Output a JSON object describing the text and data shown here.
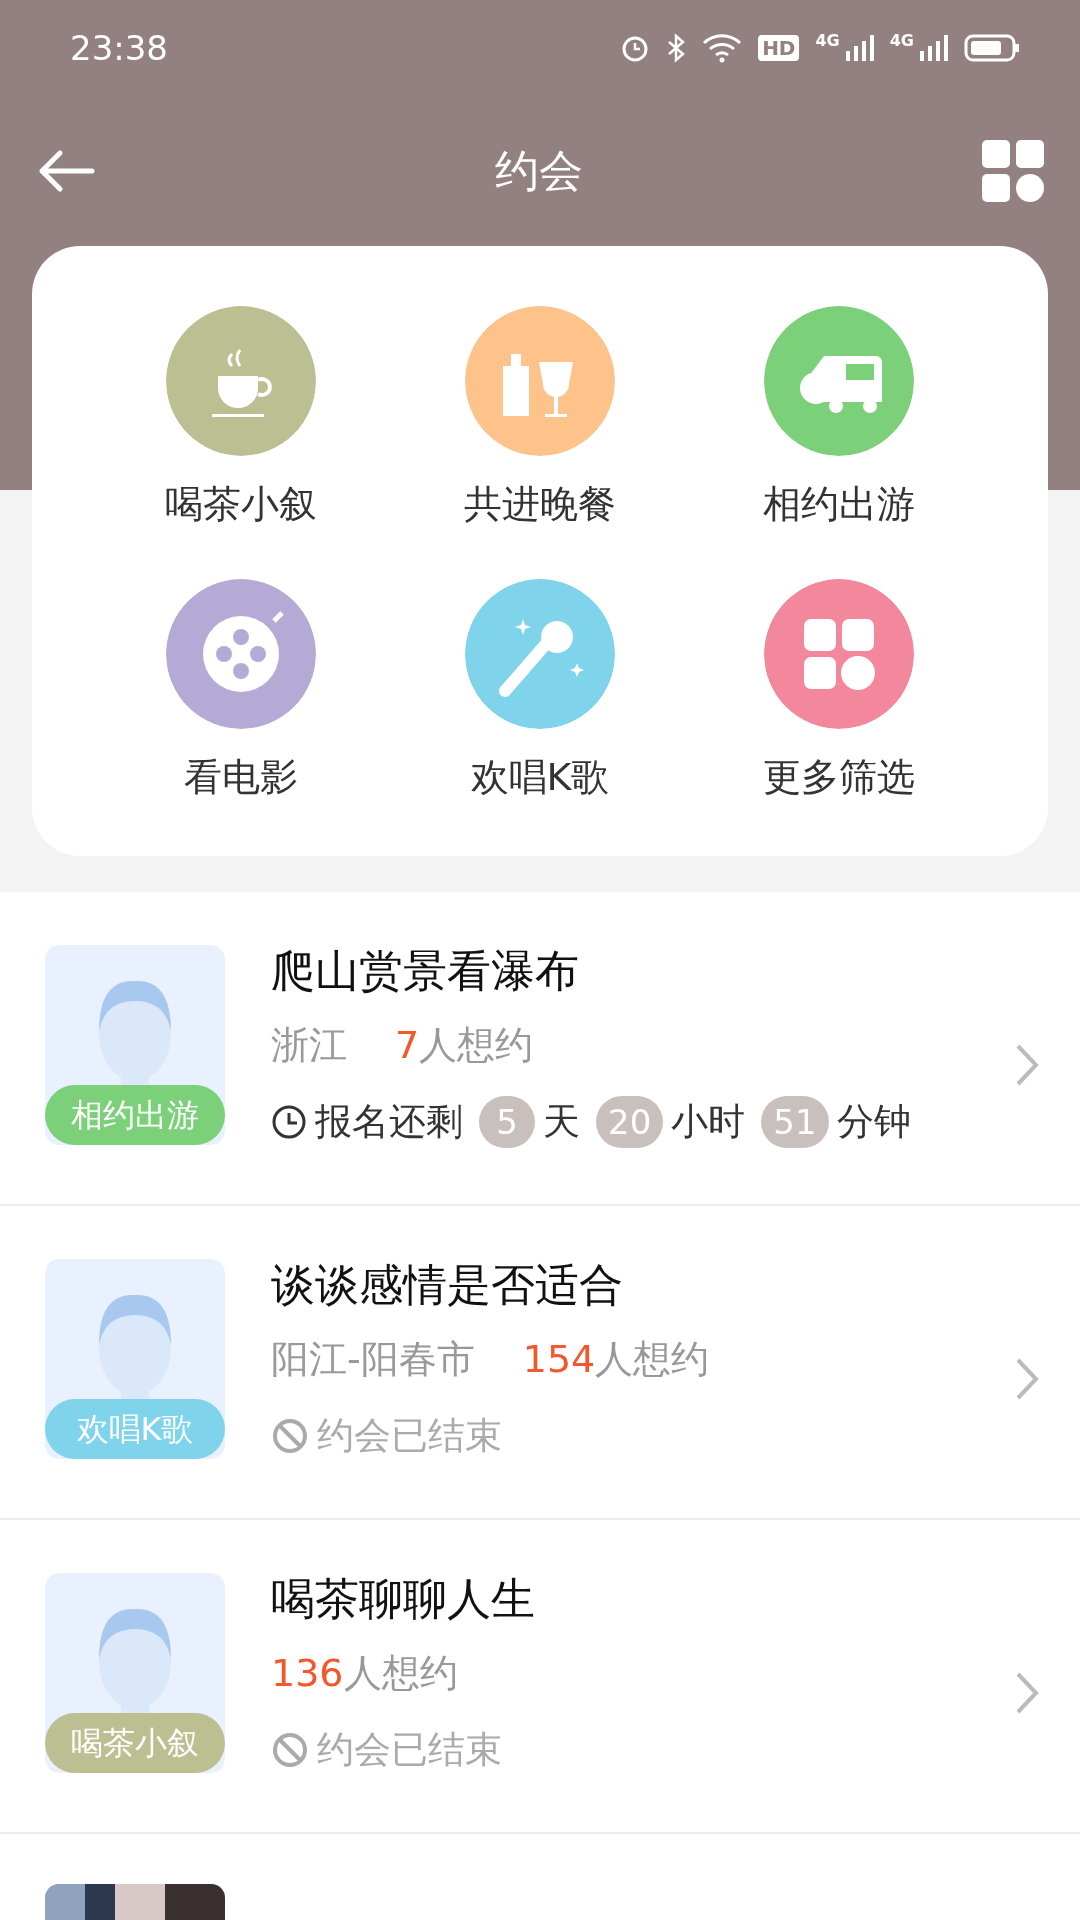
{
  "status_bar": {
    "time": "23:38",
    "hd_badge": "HD",
    "network_labels": [
      "4G",
      "4G"
    ]
  },
  "header": {
    "title": "约会"
  },
  "categories": [
    {
      "label": "喝茶小叙",
      "kind": "tea",
      "color": "#bcbf92"
    },
    {
      "label": "共进晚餐",
      "kind": "dinner",
      "color": "#fec38a"
    },
    {
      "label": "相约出游",
      "kind": "travel",
      "color": "#7dd07a"
    },
    {
      "label": "看电影",
      "kind": "movie",
      "color": "#b5aad6"
    },
    {
      "label": "欢唱K歌",
      "kind": "karaoke",
      "color": "#7fd3ea"
    },
    {
      "label": "更多筛选",
      "kind": "more",
      "color": "#f3889d"
    }
  ],
  "listings": [
    {
      "title": "爬山赏景看瀑布",
      "location": "浙江",
      "count": "7",
      "count_suffix": "人想约",
      "tag": "相约出游",
      "color": "#7dd07a",
      "kind": "countdown",
      "status_label": "报名还剩",
      "countdown": [
        {
          "value": "5",
          "unit": "天"
        },
        {
          "value": "20",
          "unit": "小时"
        },
        {
          "value": "51",
          "unit": "分钟"
        }
      ]
    },
    {
      "title": "谈谈感情是否适合",
      "location": "阳江-阳春市",
      "count": "154",
      "count_suffix": "人想约",
      "tag": "欢唱K歌",
      "color": "#7fd3ea",
      "kind": "ended",
      "status_label": "约会已结束"
    },
    {
      "title": "喝茶聊聊人生",
      "count": "136",
      "count_suffix": "人想约",
      "tag": "喝茶小叙",
      "color": "#bcbf92",
      "kind": "ended",
      "status_label": "约会已结束"
    },
    {
      "kind": "partial"
    }
  ]
}
